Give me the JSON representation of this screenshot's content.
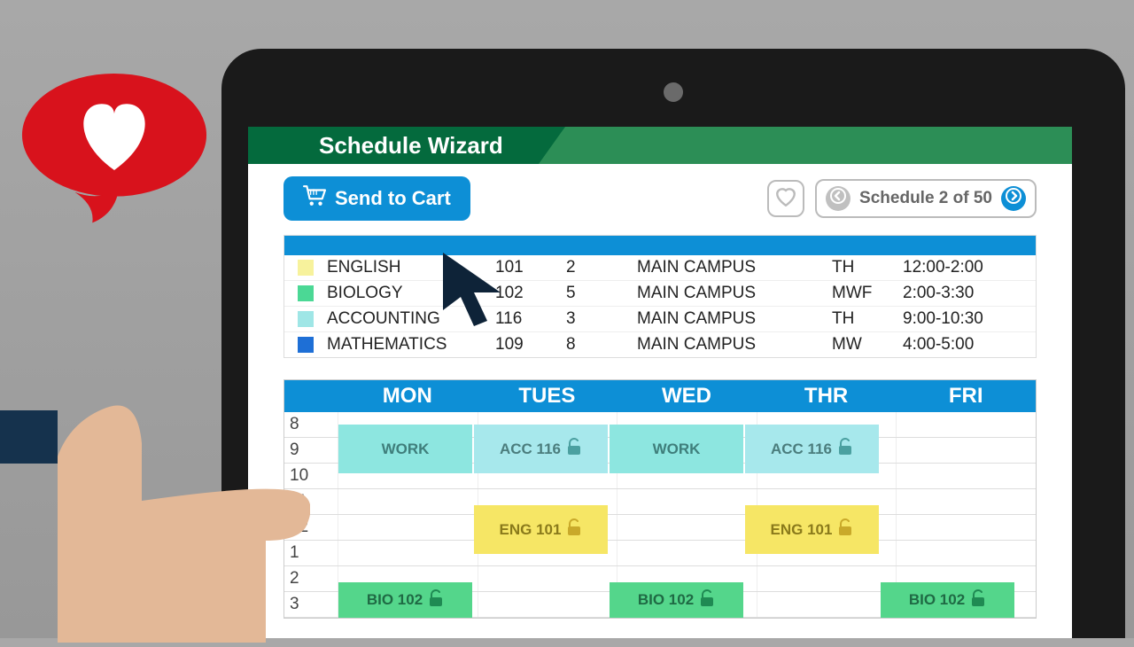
{
  "header": {
    "title": "Schedule Wizard"
  },
  "toolbar": {
    "send_to_cart_label": "Send to Cart",
    "pager_label": "Schedule 2 of 50"
  },
  "courses": [
    {
      "color": "yellow",
      "name": "ENGLISH",
      "num": "101",
      "credits": "2",
      "campus": "MAIN CAMPUS",
      "days": "TH",
      "time": "12:00-2:00"
    },
    {
      "color": "green",
      "name": "BIOLOGY",
      "num": "102",
      "credits": "5",
      "campus": "MAIN CAMPUS",
      "days": "MWF",
      "time": "2:00-3:30"
    },
    {
      "color": "cyan",
      "name": "ACCOUNTING",
      "num": "116",
      "credits": "3",
      "campus": "MAIN CAMPUS",
      "days": "TH",
      "time": "9:00-10:30"
    },
    {
      "color": "blue",
      "name": "MATHEMATICS",
      "num": "109",
      "credits": "8",
      "campus": "MAIN CAMPUS",
      "days": "MW",
      "time": "4:00-5:00"
    }
  ],
  "calendar": {
    "days": [
      "MON",
      "TUES",
      "WED",
      "THR",
      "FRI"
    ],
    "hours": [
      "8",
      "9",
      "10",
      "11",
      "12",
      "1",
      "2",
      "3"
    ],
    "events": {
      "work_mon": "WORK",
      "work_wed": "WORK",
      "acc_tue": "ACC 116",
      "acc_thr": "ACC 116",
      "eng_tue": "ENG 101",
      "eng_thr": "ENG 101",
      "bio_mon": "BIO 102",
      "bio_wed": "BIO 102",
      "bio_fri": "BIO 102"
    }
  }
}
